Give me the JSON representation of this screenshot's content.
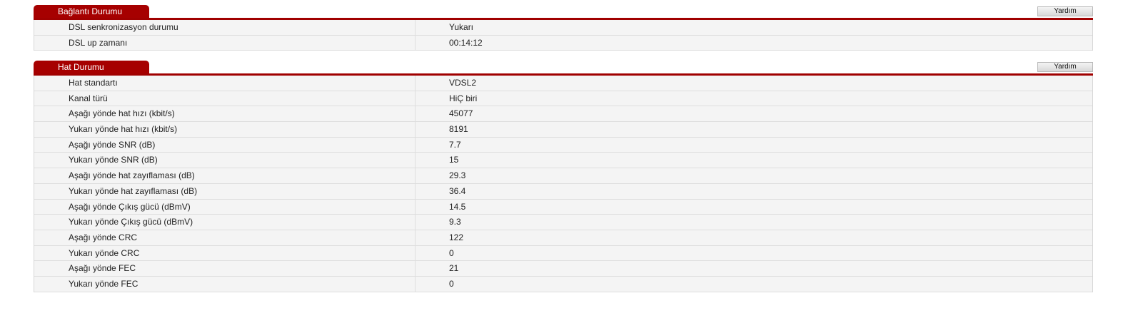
{
  "connection": {
    "title": "Bağlantı Durumu",
    "help": "Yardım",
    "rows": [
      {
        "label": "DSL senkronizasyon durumu",
        "value": "Yukarı"
      },
      {
        "label": "DSL up zamanı",
        "value": "00:14:12"
      }
    ]
  },
  "line": {
    "title": "Hat Durumu",
    "help": "Yardım",
    "rows": [
      {
        "label": "Hat standartı",
        "value": "VDSL2"
      },
      {
        "label": "Kanal türü",
        "value": "HiÇ biri"
      },
      {
        "label": "Aşağı yönde hat hızı (kbit/s)",
        "value": "45077"
      },
      {
        "label": "Yukarı yönde hat hızı (kbit/s)",
        "value": "8191"
      },
      {
        "label": "Aşağı yönde SNR (dB)",
        "value": "7.7"
      },
      {
        "label": "Yukarı yönde SNR (dB)",
        "value": "15"
      },
      {
        "label": "Aşağı yönde hat zayıflaması (dB)",
        "value": "29.3"
      },
      {
        "label": "Yukarı yönde hat zayıflaması (dB)",
        "value": "36.4"
      },
      {
        "label": "Aşağı yönde Çıkış gücü (dBmV)",
        "value": "14.5"
      },
      {
        "label": "Yukarı yönde Çıkış gücü (dBmV)",
        "value": "9.3"
      },
      {
        "label": "Aşağı yönde CRC",
        "value": "122"
      },
      {
        "label": "Yukarı yönde CRC",
        "value": "0"
      },
      {
        "label": "Aşağı yönde FEC",
        "value": "21"
      },
      {
        "label": "Yukarı yönde FEC",
        "value": "0"
      }
    ]
  },
  "colors": {
    "accent": "#a60000",
    "row_background": "#f4f4f4"
  }
}
